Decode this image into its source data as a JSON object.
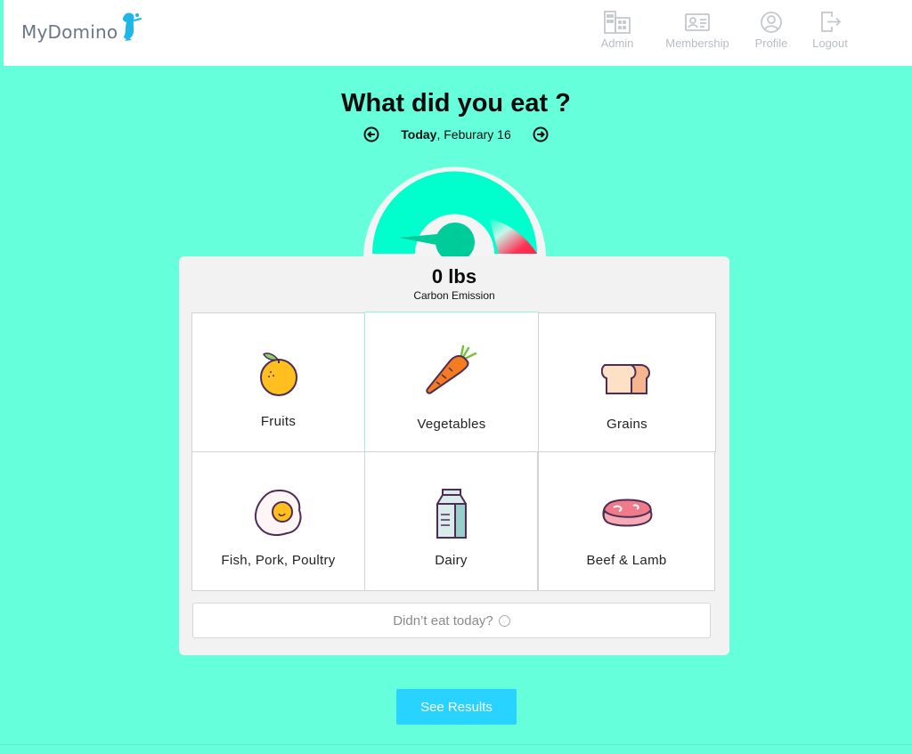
{
  "header": {
    "logo_text": "MyDomino",
    "nav": [
      {
        "label": "Admin",
        "icon": "building-icon"
      },
      {
        "label": "Membership",
        "icon": "id-card-icon"
      },
      {
        "label": "Profile",
        "icon": "user-circle-icon"
      },
      {
        "label": "Logout",
        "icon": "logout-icon"
      }
    ]
  },
  "main": {
    "title": "What did you eat ?",
    "date": {
      "today": "Today",
      "rest": ", Feburary 16"
    },
    "gauge": {
      "level": 0
    },
    "emission": {
      "value": "0 lbs",
      "label": "Carbon Emission"
    },
    "categories": [
      {
        "label": "Fruits",
        "icon": "orange-icon"
      },
      {
        "label": "Vegetables",
        "icon": "carrot-icon",
        "selected": true
      },
      {
        "label": "Grains",
        "icon": "bread-icon"
      },
      {
        "label": "Fish, Pork, Poultry",
        "icon": "egg-icon"
      },
      {
        "label": "Dairy",
        "icon": "milk-carton-icon"
      },
      {
        "label": "Beef & Lamb",
        "icon": "steak-icon"
      }
    ],
    "no_eat_label": "Didn’t eat today?",
    "see_results_label": "See Results"
  },
  "colors": {
    "background": "#66ffdb",
    "accent": "#28d3ff",
    "gauge_fill": "#00ffcc",
    "gauge_needle": "#00cc99",
    "gauge_high": "#ff3355"
  }
}
